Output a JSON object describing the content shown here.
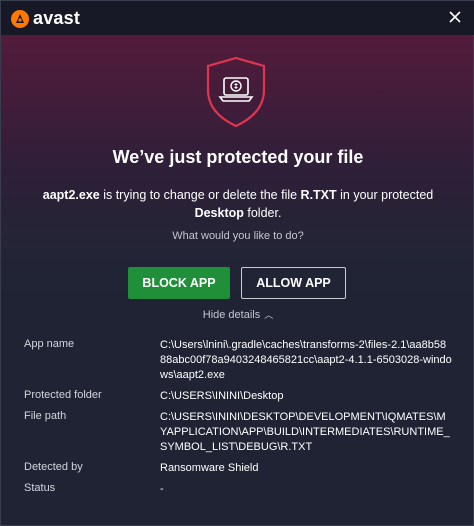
{
  "app": {
    "brand": "avast",
    "accent_color": "#ff7800"
  },
  "headline": "We’ve just protected your file",
  "message": {
    "process": "aapt2.exe",
    "text1": " is trying to change or delete the file ",
    "file": "R.TXT",
    "text2": " in your protected ",
    "folder": "Desktop",
    "text3": " folder."
  },
  "question": "What would you like to do?",
  "buttons": {
    "block": "BLOCK APP",
    "allow": "ALLOW APP",
    "block_color": "#1f8f3a"
  },
  "hide_details": "Hide details",
  "details": {
    "app_name": {
      "label": "App name",
      "value": "C:\\Users\\lnini\\.gradle\\caches\\transforms-2\\files-2.1\\aa8b5888abc00f78a9403248465821cc\\aapt2-4.1.1-6503028-windows\\aapt2.exe"
    },
    "protected_folder": {
      "label": "Protected folder",
      "value": "C:\\USERS\\ININI\\Desktop"
    },
    "file_path": {
      "label": "File path",
      "value": "C:\\USERS\\ININI\\DESKTOP\\DEVELOPMENT\\IQMATES\\MYAPPLICATION\\APP\\BUILD\\INTERMEDIATES\\RUNTIME_SYMBOL_LIST\\DEBUG\\R.TXT"
    },
    "detected_by": {
      "label": "Detected by",
      "value": "Ransomware Shield"
    },
    "status": {
      "label": "Status",
      "value": "-"
    }
  }
}
